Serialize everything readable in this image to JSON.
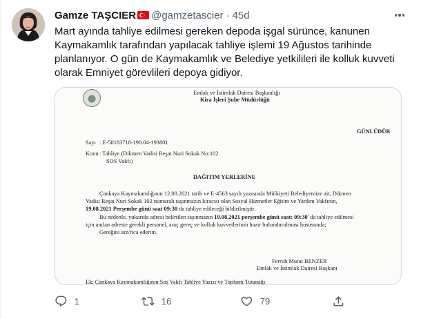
{
  "tweet": {
    "author_name": "Gamze TAŞCIER",
    "handle": "@gamzetascier",
    "separator": "·",
    "time": "45d",
    "text": "Mart ayında tahliye edilmesi gereken depoda işgal sürünce, kanunen Kaymakamlık tarafından yapılacak tahliye işlemi 19 Ağustos tarihinde planlanıyor. O gün de Kaymakamlık ve Belediye yetkilileri ile kolluk kuvveti olarak Emniyet görevlileri depoya gidiyor."
  },
  "document": {
    "header_line1": "Emlak ve İstimlak Dairesi Başkanlığı",
    "header_line2": "Kira İşleri Şube Müdürlüğü",
    "gunludur": "GÜNLÜDÜR",
    "sayi_label": "Sayı",
    "sayi_value": ": E-50183718-190.04-193801",
    "konu_label": "Konu",
    "konu_value_1": ": Tahliye (Dikmen Vadisi Reşat Nuri Sokak No:102",
    "konu_value_2": "SOS Vakfı)",
    "dagitim": "DAĞITIM YERLERİNE",
    "p1_l1": "Çankaya Kaymakamlığının 12.08.2021 tarih ve E-4563 sayılı yazısında Mülkiyeti Belediyemize ait, Dikmen",
    "p1_l2": "Vadisi Reşat Nuri Sokak 102 numaralı taşınmazın kiracısı olan Sosyal Hizmetler Eğitim ve Yardım Vakfının,",
    "p1_l3_bold": "19.08.2021 Perşembe günü saat 09:30",
    "p1_l3_rest": " da tahliye edileceği bildirilmiştir.",
    "p2_l1_a": "Bu nedenle, yukarıda adresi belirtilen taşınmazın ",
    "p2_l1_bold": "19.08.2021 perşembe günü saat: 09:30",
    "p2_l1_b": "' da tahliye edilmesi",
    "p2_l2": "için anılan adreste gerekli personel, araç gereç ve kolluk kuvvetlerinin hazır bulundurulması hususunda;",
    "p2_l3": "Gereğini arz/rica ederim.",
    "sign_name": "Ferruh Murat BENZER",
    "sign_title": "Emlak ve İstimlak Dairesi Başkanı",
    "ek": "Ek: Çankaya Kaymakamlığının Sos Vakfı Tahliye Yazısı ve Toplantı Tutanağı"
  },
  "actions": {
    "reply_count": "1",
    "retweet_count": "16",
    "like_count": "79"
  },
  "icons": {
    "verified_flag": "turkey-flag-icon",
    "more": "more-icon",
    "reply": "reply-icon",
    "retweet": "retweet-icon",
    "like": "heart-icon",
    "share": "share-icon"
  },
  "colors": {
    "text": "#0f1419",
    "secondary": "#536471",
    "border": "#cfd9de",
    "flag_red": "#e30a17"
  }
}
